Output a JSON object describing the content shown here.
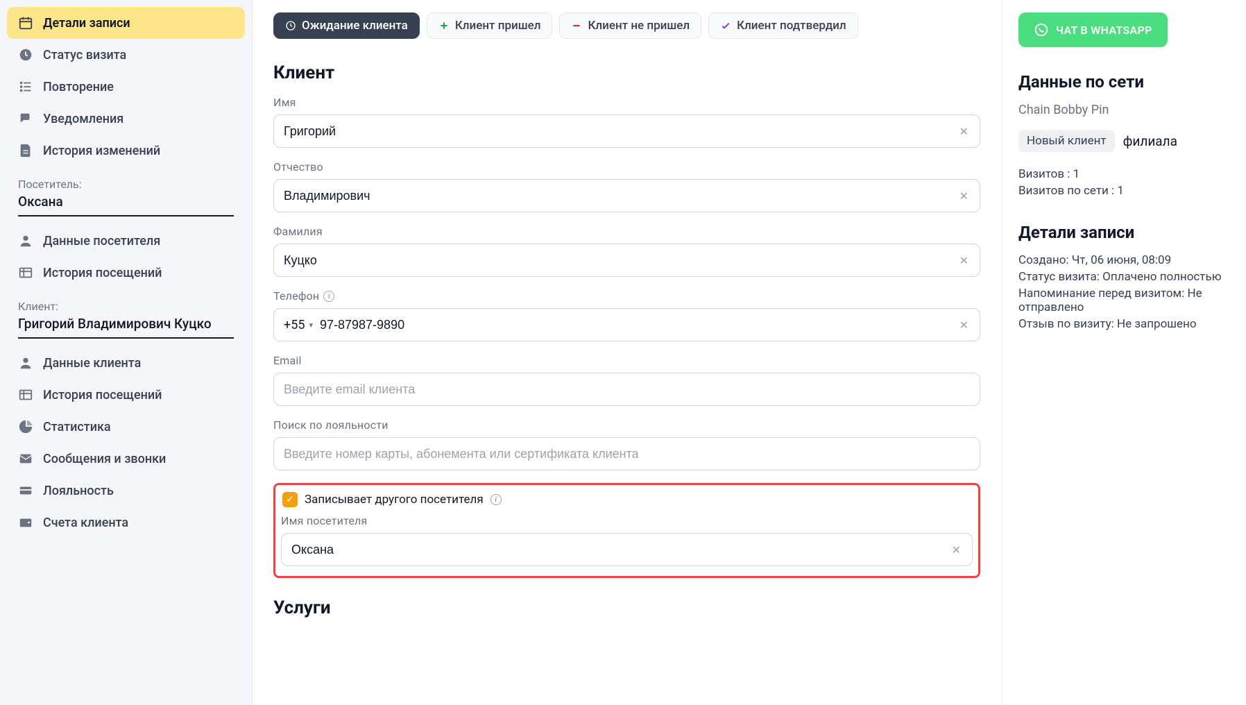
{
  "sidebar": {
    "items": [
      {
        "label": "Детали записи",
        "icon": "calendar"
      },
      {
        "label": "Статус визита",
        "icon": "clock"
      },
      {
        "label": "Повторение",
        "icon": "list"
      },
      {
        "label": "Уведомления",
        "icon": "comments"
      },
      {
        "label": "История изменений",
        "icon": "file"
      }
    ],
    "visitor_label": "Посетитель:",
    "visitor_value": "Оксана",
    "visitor_items": [
      {
        "label": "Данные посетителя",
        "icon": "user"
      },
      {
        "label": "История посещений",
        "icon": "table"
      }
    ],
    "client_label": "Клиент:",
    "client_value": "Григорий  Владимирович Куцко",
    "client_items": [
      {
        "label": "Данные клиента",
        "icon": "user"
      },
      {
        "label": "История посещений",
        "icon": "table"
      },
      {
        "label": "Статистика",
        "icon": "pie"
      },
      {
        "label": "Сообщения и звонки",
        "icon": "envelope"
      },
      {
        "label": "Лояльность",
        "icon": "card"
      },
      {
        "label": "Счета клиента",
        "icon": "wallet"
      }
    ]
  },
  "status_pills": {
    "waiting": "Ожидание клиента",
    "arrived": "Клиент пришел",
    "noshow": "Клиент не пришел",
    "confirmed": "Клиент подтвердил"
  },
  "client_form": {
    "heading": "Клиент",
    "name_label": "Имя",
    "name_value": "Григорий",
    "patronymic_label": "Отчество",
    "patronymic_value": "Владимирович",
    "surname_label": "Фамилия",
    "surname_value": "Куцко",
    "phone_label": "Телефон",
    "phone_prefix": "+55",
    "phone_value": "97-87987-9890",
    "email_label": "Email",
    "email_placeholder": "Введите email клиента",
    "loyalty_label": "Поиск по лояльности",
    "loyalty_placeholder": "Введите номер карты, абонемента или сертификата клиента",
    "other_visitor_checkbox": "Записывает другого посетителя",
    "visitor_name_label": "Имя посетителя",
    "visitor_name_value": "Оксана",
    "services_heading": "Услуги"
  },
  "right": {
    "whatsapp": "ЧАТ В WHATSAPP",
    "network_heading": "Данные по сети",
    "chain_name": "Chain Bobby Pin",
    "new_client_badge": "Новый клиент",
    "branch_suffix": "филиала",
    "visits": "Визитов : 1",
    "network_visits": "Визитов по сети : 1",
    "details_heading": "Детали записи",
    "created": "Создано: Чт, 06 июня, 08:09",
    "visit_status": "Статус визита: Оплачено полностью",
    "reminder": "Напоминание перед визитом: Не отправлено",
    "review": "Отзыв по визиту: Не запрошено"
  }
}
